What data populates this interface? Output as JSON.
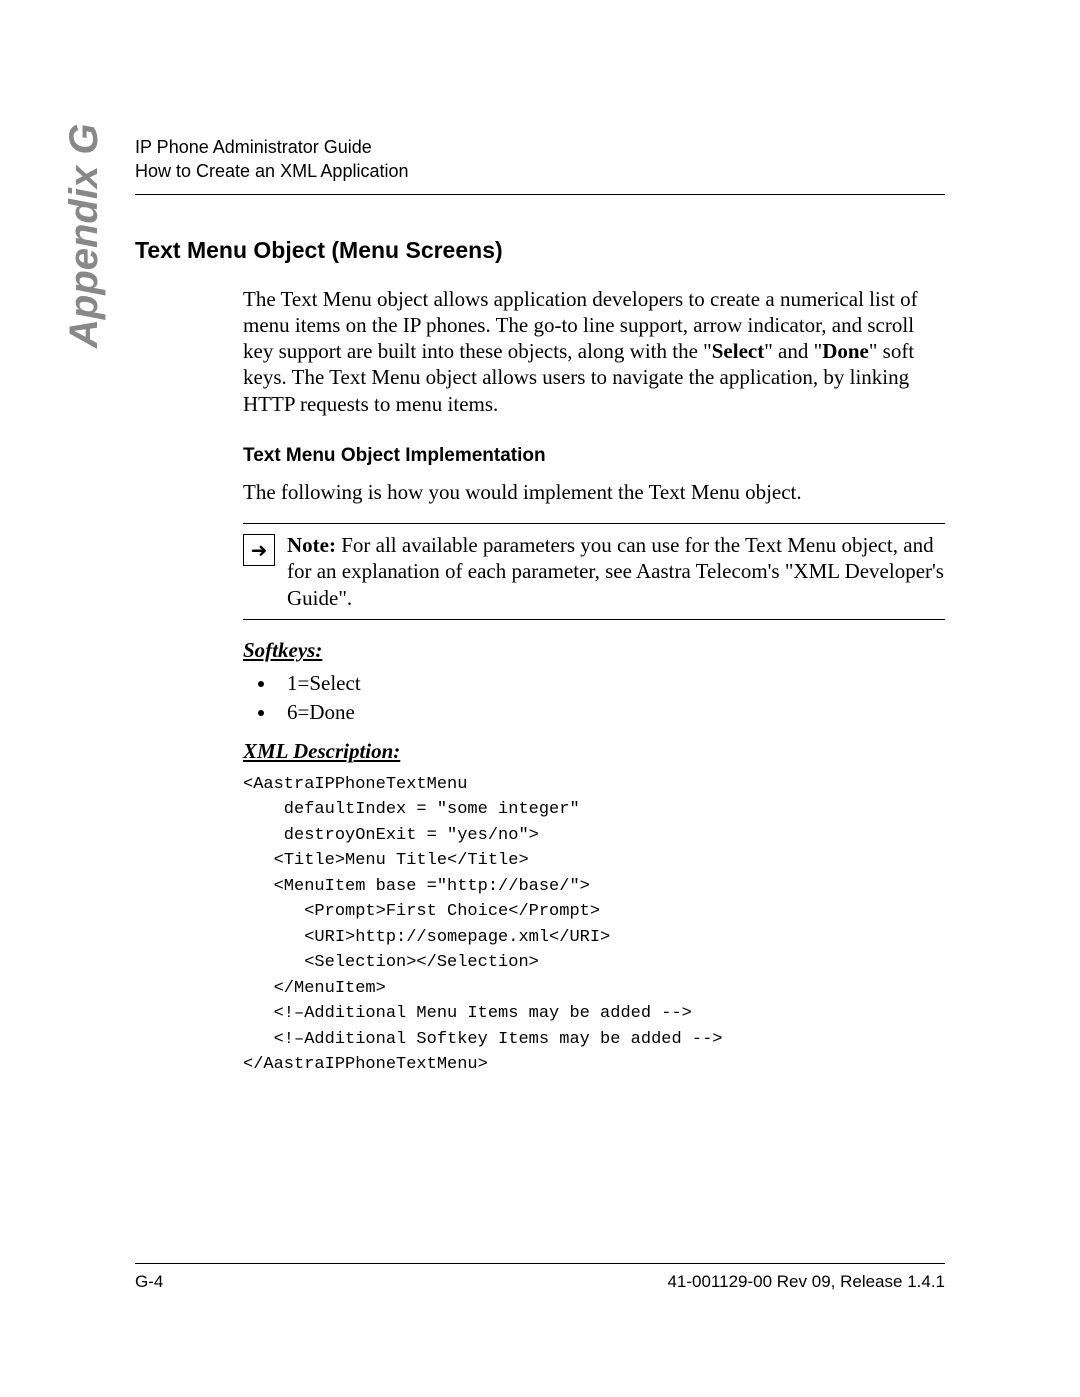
{
  "header": {
    "line1": "IP Phone Administrator Guide",
    "line2": "How to Create an XML Application"
  },
  "tab": "Appendix G",
  "section": {
    "title": "Text Menu Object (Menu Screens)",
    "intro_parts": [
      "The Text Menu object allows application developers to create a numerical list of menu items on the IP phones. The go-to line support, arrow indicator, and scroll key support are built into these objects, along with the \"",
      "Select",
      "\" and \"",
      "Done",
      "\" soft keys. The Text Menu object allows users to navigate the application, by linking HTTP requests to menu items."
    ],
    "impl_heading": "Text Menu Object Implementation",
    "impl_para": "The following is how you would implement the Text Menu object.",
    "note_label": "Note:",
    "note_body": " For all available parameters you can use for the Text Menu object, and for an explanation of each parameter, see Aastra Telecom's \"XML Developer's Guide\".",
    "softkeys_heading": "Softkeys:",
    "softkeys": [
      "1=Select",
      "6=Done"
    ],
    "xml_heading": "XML Description:",
    "xml_code": "<AastraIPPhoneTextMenu\n    defaultIndex = \"some integer\"\n    destroyOnExit = \"yes/no\">\n   <Title>Menu Title</Title>\n   <MenuItem base =\"http://base/\">\n      <Prompt>First Choice</Prompt>\n      <URI>http://somepage.xml</URI>\n      <Selection></Selection>\n   </MenuItem>\n   <!–Additional Menu Items may be added -->\n   <!–Additional Softkey Items may be added -->\n</AastraIPPhoneTextMenu>"
  },
  "footer": {
    "left": "G-4",
    "right": "41-001129-00 Rev 09, Release 1.4.1"
  }
}
